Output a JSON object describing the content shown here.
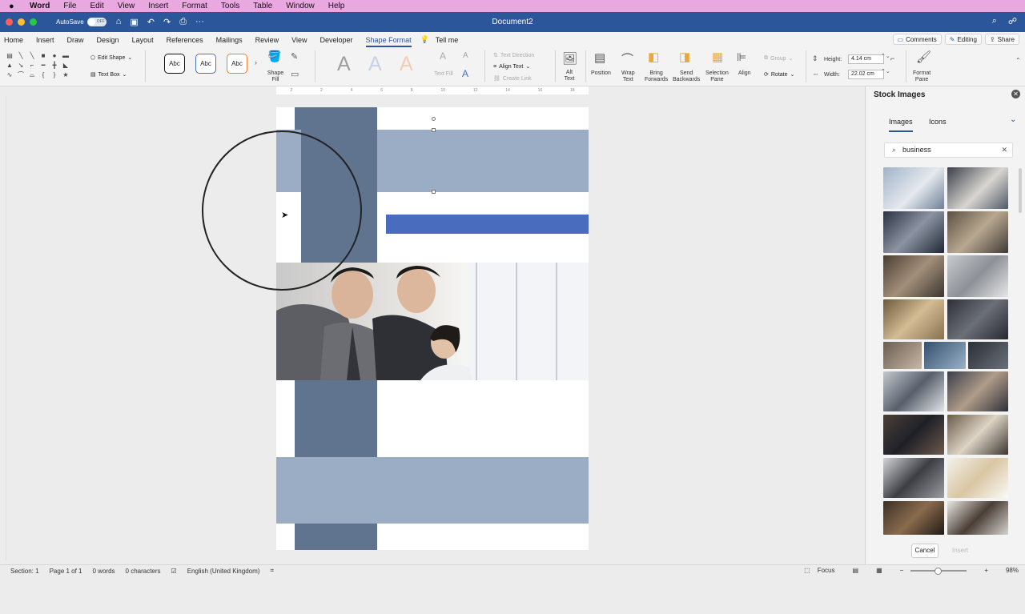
{
  "mac_menu": {
    "apple": "",
    "app": "Word",
    "items": [
      "File",
      "Edit",
      "View",
      "Insert",
      "Format",
      "Tools",
      "Table",
      "Window",
      "Help"
    ]
  },
  "titlebar": {
    "autosave_label": "AutoSave",
    "toggle_state": "OFF",
    "document_title": "Document2"
  },
  "tabs": [
    "Home",
    "Insert",
    "Draw",
    "Design",
    "Layout",
    "References",
    "Mailings",
    "Review",
    "View",
    "Developer",
    "Shape Format",
    "Tell me"
  ],
  "active_tab": "Shape Format",
  "tab_buttons": {
    "comments": "Comments",
    "editing": "Editing",
    "share": "Share"
  },
  "ribbon": {
    "edit_shape": "Edit Shape",
    "text_box": "Text Box",
    "style_abc": "Abc",
    "shape_fill": "Shape\nFill",
    "wordart_A": "A",
    "text_fill": "Text Fill",
    "text_direction": "Text Direction",
    "align_text": "Align Text",
    "create_link": "Create Link",
    "alt_text": "Alt\nText",
    "position": "Position",
    "wrap_text": "Wrap\nText",
    "bring_forwards": "Bring\nForwards",
    "send_backwards": "Send\nBackwards",
    "selection_pane": "Selection\nPane",
    "align": "Align",
    "group": "Group",
    "rotate": "Rotate",
    "height_label": "Height:",
    "height_value": "4.14 cm",
    "width_label": "Width:",
    "width_value": "22.02 cm",
    "format_pane": "Format\nPane"
  },
  "ruler_numbers": [
    "2",
    "",
    "2",
    "4",
    "6",
    "8",
    "10",
    "12",
    "14",
    "16",
    "18"
  ],
  "pane": {
    "title": "Stock Images",
    "tabs": [
      "Images",
      "Icons"
    ],
    "active_tab": "Images",
    "search_value": "business",
    "cancel_label": "Cancel",
    "insert_label": "Insert"
  },
  "status": {
    "section": "Section: 1",
    "page": "Page 1 of 1",
    "words": "0 words",
    "characters": "0 characters",
    "language": "English (United Kingdom)",
    "focus": "Focus",
    "zoom": "98%"
  },
  "colors": {
    "dark_band": "#607490",
    "light_band": "#9aadc4",
    "accent_bar": "#4a6cbf",
    "title_blue": "#2b579a"
  }
}
